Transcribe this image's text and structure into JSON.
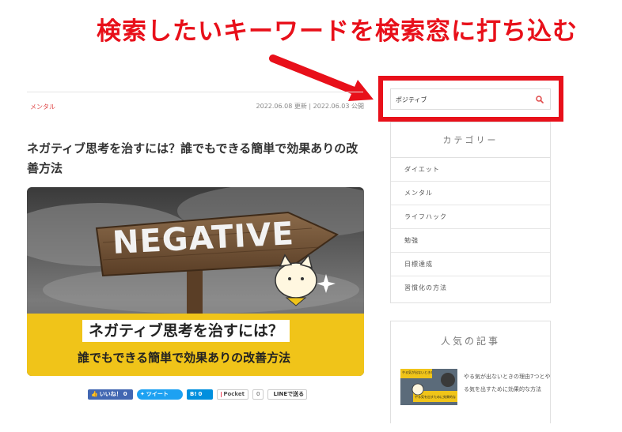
{
  "annotation": {
    "text": "検索したいキーワードを検索窓に打ち込む",
    "color": "#e8101a"
  },
  "article": {
    "category": "メンタル",
    "dates": "2022.06.08 更新 | 2022.06.03 公開",
    "title": "ネガティブ思考を治すには？誰でもできる簡単で効果ありの改善方法",
    "hero": {
      "sign_word": "NEGATIVE",
      "line1": "ネガティブ思考を治すには？",
      "line2": "誰でもできる簡単で効果ありの改善方法",
      "banner_color": "#f0c419"
    }
  },
  "share": {
    "like_label": "いいね！",
    "like_count": "0",
    "tweet_label": "ツイート",
    "hatena_label": "B!",
    "hatena_count": "0",
    "pocket_label": "Pocket",
    "pocket_count": "0",
    "line_label": "LINEで送る"
  },
  "sidebar": {
    "search": {
      "value": "ポジティブ",
      "icon": "search-icon"
    },
    "categories": {
      "heading": "カテゴリー",
      "items": [
        {
          "label": "ダイエット"
        },
        {
          "label": "メンタル"
        },
        {
          "label": "ライフハック"
        },
        {
          "label": "勉強"
        },
        {
          "label": "日標達成"
        },
        {
          "label": "習慣化の方法"
        }
      ]
    },
    "popular": {
      "heading": "人気の記事",
      "items": [
        {
          "title": "やる気が出ないときの理由7つとやる気を出すために効果的な方法",
          "thumb_caption_top": "やる気が出ないときの理由7つ",
          "thumb_caption_bottom": "やる気を出すために効果的な方法"
        }
      ]
    }
  },
  "colors": {
    "accent_red": "#e04848",
    "link_blue": "#4267b2"
  }
}
